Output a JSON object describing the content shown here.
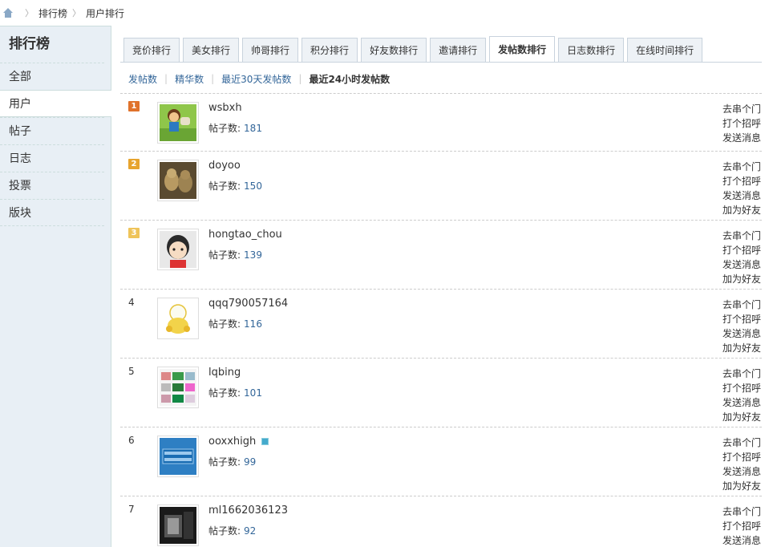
{
  "breadcrumb": [
    "排行榜",
    "用户排行"
  ],
  "sidebar": {
    "title": "排行榜",
    "items": [
      "全部",
      "用户",
      "帖子",
      "日志",
      "投票",
      "版块"
    ],
    "active_index": 1
  },
  "tabs": [
    "竞价排行",
    "美女排行",
    "帅哥排行",
    "积分排行",
    "好友数排行",
    "邀请排行",
    "发帖数排行",
    "日志数排行",
    "在线时间排行"
  ],
  "active_tab": 6,
  "subtabs": [
    "发帖数",
    "精华数",
    "最近30天发帖数",
    "最近24小时发帖数"
  ],
  "active_subtab": 3,
  "stat_label": "帖子数:",
  "colors": {
    "rank1": "#e0722b",
    "rank2": "#e7a42e",
    "rank3": "#efc45a",
    "link": "#336699"
  },
  "users": [
    {
      "rank": "1",
      "name": "wsbxh",
      "count": "181",
      "online": false,
      "actions": [
        "去串个门",
        "打个招呼",
        "发送消息"
      ],
      "avatar": "cartoon-kid-icon"
    },
    {
      "rank": "2",
      "name": "doyoo",
      "count": "150",
      "online": false,
      "actions": [
        "去串个门",
        "打个招呼",
        "发送消息",
        "加为好友"
      ],
      "avatar": "cats-photo-icon"
    },
    {
      "rank": "3",
      "name": "hongtao_chou",
      "count": "139",
      "online": false,
      "actions": [
        "去串个门",
        "打个招呼",
        "发送消息",
        "加为好友"
      ],
      "avatar": "cartoon-face-icon"
    },
    {
      "rank": "4",
      "name": "qqq790057164",
      "count": "116",
      "online": false,
      "actions": [
        "去串个门",
        "打个招呼",
        "发送消息",
        "加为好友"
      ],
      "avatar": "lucky-cat-icon"
    },
    {
      "rank": "5",
      "name": "lqbing",
      "count": "101",
      "online": false,
      "actions": [
        "去串个门",
        "打个招呼",
        "发送消息",
        "加为好友"
      ],
      "avatar": "collage-icon"
    },
    {
      "rank": "6",
      "name": "ooxxhigh",
      "count": "99",
      "online": true,
      "actions": [
        "去串个门",
        "打个招呼",
        "发送消息",
        "加为好友"
      ],
      "avatar": "amex-logo-icon"
    },
    {
      "rank": "7",
      "name": "ml1662036123",
      "count": "92",
      "online": false,
      "actions": [
        "去串个门",
        "打个招呼",
        "发送消息"
      ],
      "avatar": "bw-photo-icon"
    }
  ]
}
